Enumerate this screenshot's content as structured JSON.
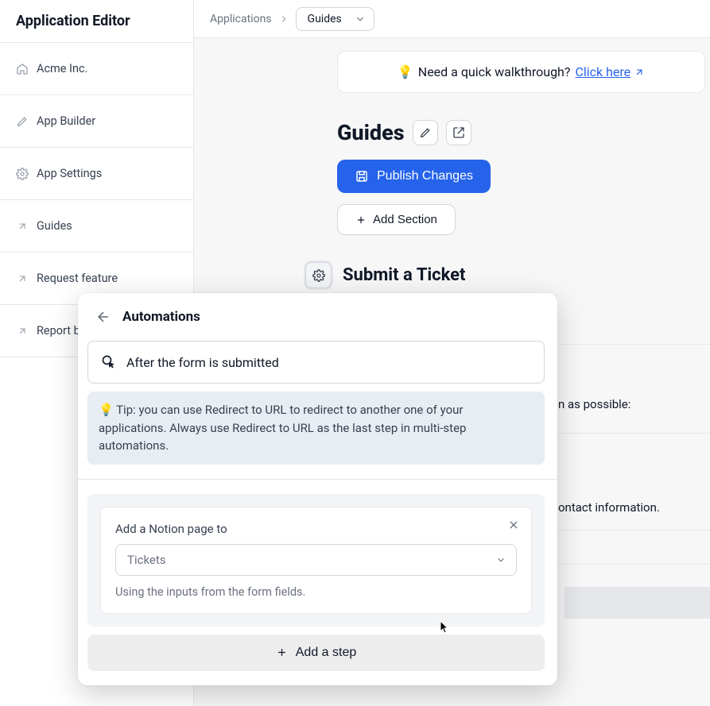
{
  "sidebar": {
    "title": "Application Editor",
    "items": [
      {
        "label": "Acme Inc."
      },
      {
        "label": "App Builder"
      },
      {
        "label": "App Settings"
      },
      {
        "label": "Guides"
      },
      {
        "label": "Request feature"
      },
      {
        "label": "Report bug"
      }
    ]
  },
  "breadcrumb": {
    "root": "Applications",
    "current": "Guides"
  },
  "walkthrough": {
    "prefix": "Need a quick walkthrough? ",
    "link": "Click here"
  },
  "page": {
    "title": "Guides",
    "publish": "Publish Changes",
    "add_section": "Add Section",
    "section_title": "Submit a Ticket"
  },
  "partial": {
    "line1": "n as possible:",
    "line2": "ontact information."
  },
  "modal": {
    "title": "Automations",
    "trigger": "After the form is submitted",
    "tip": "💡 Tip: you can use Redirect to URL to redirect to another one of your applications. Always use Redirect to URL as the last step in multi-step automations.",
    "step_label": "Add a Notion page to",
    "step_select": "Tickets",
    "step_helper": "Using the inputs from the form fields.",
    "add_step": "Add a step"
  }
}
